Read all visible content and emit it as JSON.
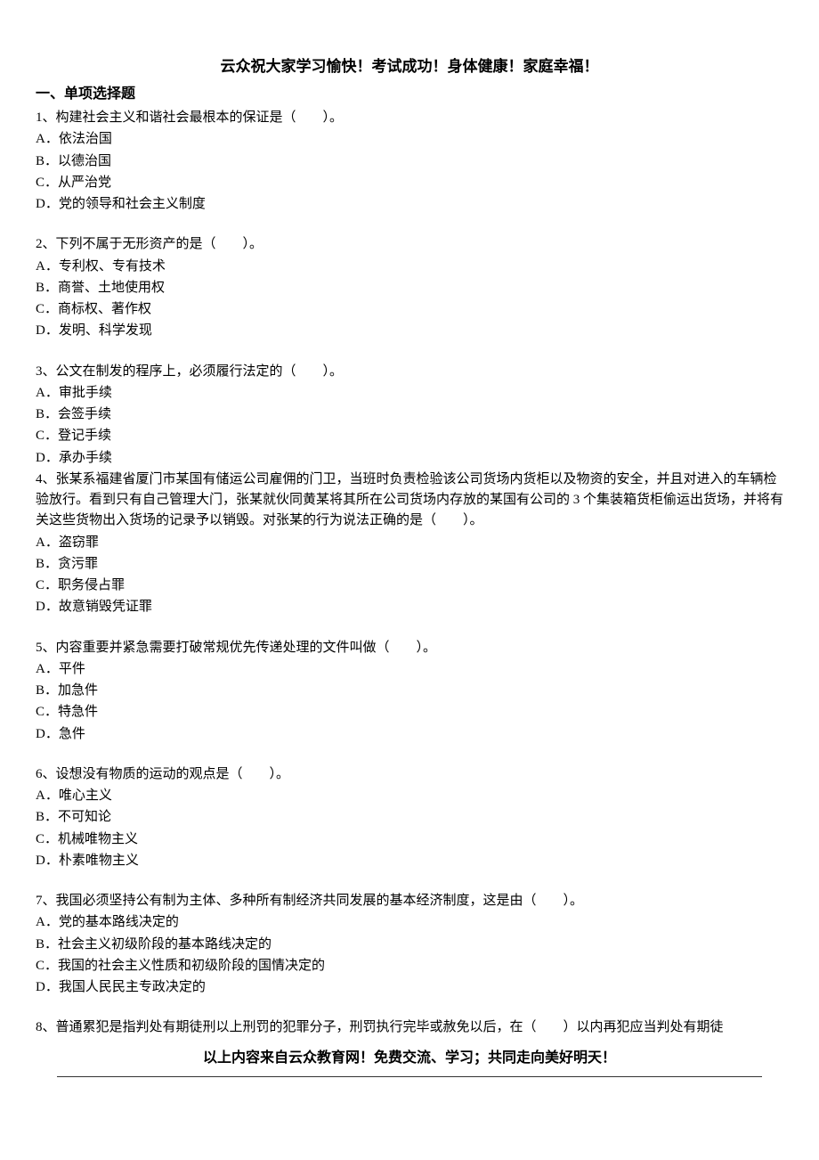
{
  "header": "云众祝大家学习愉快！考试成功！身体健康！家庭幸福！",
  "section_title": "一、单项选择题",
  "questions": [
    {
      "stem": "1、构建社会主义和谐社会最根本的保证是（　　）。",
      "opts": [
        "A．依法治国",
        "B．以德治国",
        "C．从严治党",
        "D．党的领导和社会主义制度"
      ]
    },
    {
      "stem": "2、下列不属于无形资产的是（　　）。",
      "opts": [
        "A．专利权、专有技术",
        "B．商誉、土地使用权",
        "C．商标权、著作权",
        "D．发明、科学发现"
      ]
    },
    {
      "stem": "3、公文在制发的程序上，必须履行法定的（　　）。",
      "opts": [
        "A．审批手续",
        "B．会签手续",
        "C．登记手续",
        "D．承办手续"
      ]
    },
    {
      "stem": "4、张某系福建省厦门市某国有储运公司雇佣的门卫，当班时负责检验该公司货场内货柜以及物资的安全，并且对进入的车辆检验放行。看到只有自己管理大门，张某就伙同黄某将其所在公司货场内存放的某国有公司的 3 个集装箱货柜偷运出货场，并将有关这些货物出入货场的记录予以销毁。对张某的行为说法正确的是（　　）。",
      "opts": [
        "A．盗窃罪",
        "B．贪污罪",
        "C．职务侵占罪",
        "D．故意销毁凭证罪"
      ]
    },
    {
      "stem": "5、内容重要并紧急需要打破常规优先传递处理的文件叫做（　　）。",
      "opts": [
        "A．平件",
        "B．加急件",
        "C．特急件",
        "D．急件"
      ]
    },
    {
      "stem": "6、设想没有物质的运动的观点是（　　）。",
      "opts": [
        "A．唯心主义",
        "B．不可知论",
        "C．机械唯物主义",
        "D．朴素唯物主义"
      ]
    },
    {
      "stem": "7、我国必须坚持公有制为主体、多种所有制经济共同发展的基本经济制度，这是由（　　）。",
      "opts": [
        "A．党的基本路线决定的",
        "B．社会主义初级阶段的基本路线决定的",
        "C．我国的社会主义性质和初级阶段的国情决定的",
        "D．我国人民民主专政决定的"
      ]
    },
    {
      "stem": "8、普通累犯是指判处有期徒刑以上刑罚的犯罪分子，刑罚执行完毕或赦免以后，在（　　）以内再犯应当判处有期徒",
      "opts": []
    }
  ],
  "footer": "以上内容来自云众教育网！免费交流、学习；共同走向美好明天！"
}
